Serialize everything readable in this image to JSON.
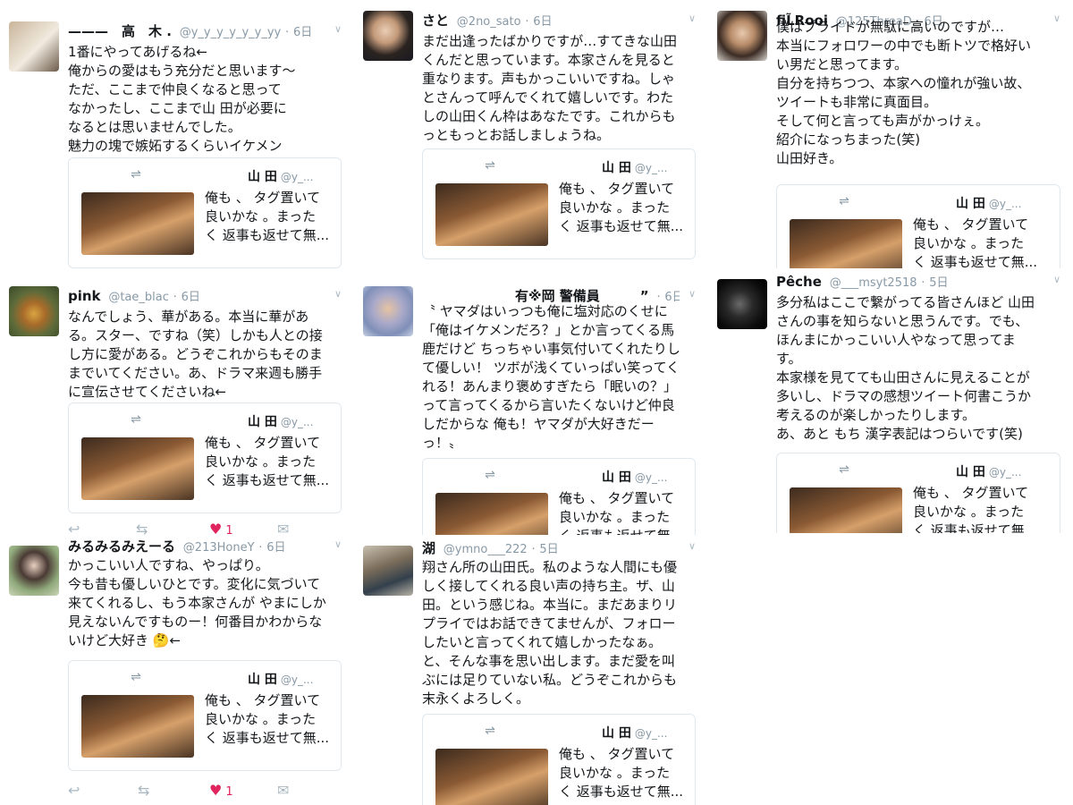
{
  "quoted": {
    "retweet_icon": "⇌",
    "name": "山 田",
    "handle": "@y_...",
    "text": "俺も 、 タグ置いて\n良いかな 。まった\nく 返事も返せて無..."
  },
  "tweets": [
    {
      "name": "———　高　木 .",
      "handle": "@y_y_y_y_y_y_yy",
      "time": "6日",
      "text": "1番にやってあげるね←\n俺からの愛はもう充分だと思います〜\nただ、ここまで仲良くなると思って\nなかったし、ここまで山 田が必要に\nなるとは思いませんでした。\n魅力の塊で嫉妬するくらいイケメン"
    },
    {
      "name": "さと",
      "handle": "@2no_sato",
      "time": "6日",
      "text": "まだ出逢ったばかりですが…すてきな山田\nくんだと思っています。本家さんを見ると\n重なります。声もかっこいいですね。しゃ\nとさんって呼んでくれて嬉しいです。わた\nしの山田くん枠はあなたです。これからも\nっともっとお話しましょうね。"
    },
    {
      "name": "fiL̃Rooi",
      "handle": "@125ThreaD",
      "time": "6日",
      "text": "僕はプライドが無駄に高いのですが…\n本当にフォロワーの中でも断トツで格好い\nい男だと思ってます。\n自分を持ちつつ、本家への憧れが強い故、\nツイートも非常に真面目。\nそして何と言っても声がかっけぇ。\n紹介になっちまった(笑)\n山田好き。"
    },
    {
      "name": "pink",
      "handle": "@tae_blac",
      "time": "6日",
      "text": "なんでしょう、華がある。本当に華があ\nる。スター、ですね（笑）しかも人との接\nし方に愛がある。どうぞこれからもそのま\nまでいてください。あ、ドラマ来週も勝手\nに宣伝させてくださいね←"
    },
    {
      "name": "有※岡 警備員　　　”",
      "handle": "",
      "time": "6日",
      "text": "〝 ヤマダはいっつも俺に塩対応のくせに\n「俺はイケメンだろ？」とか言ってくる馬\n鹿だけど ちっちゃい事気付いてくれたりし\nて優しい！ ツボが浅くていっぱい笑ってく\nれる！あんまり褒めすぎたら「眠いの？」\nって言ってくるから言いたくないけど仲良\nしだからな 俺も！ヤマダが大好きだー\nっ！〟"
    },
    {
      "name": "Pêche",
      "handle": "@___msyt2518",
      "time": "5日",
      "text": "多分私はここで繋がってる皆さんほど 山田\nさんの事を知らないと思うんです。でも、\nほんまにかっこいい人やなって思ってま\nす。\n本家様を見てても山田さんに見えることが\n多いし、ドラマの感想ツイート何書こうか\n考えるのが楽しかったりします。\nあ、あと もち 漢字表記はつらいです(笑)"
    },
    {
      "name": "みるみるみえーる",
      "handle": "@213HoneY",
      "time": "6日",
      "text": "かっこいい人ですね、やっぱり。\n今も昔も優しいひとです。変化に気づいて\n来てくれるし、もう本家さんが やまにしか\n見えないんですものー！何番目かわからな\nいけど大好き 🤔←"
    },
    {
      "name": "湖",
      "handle": "@ymno___222",
      "time": "5日",
      "text": "翔さん所の山田氏。私のような人間にも優\nしく接してくれる良い声の持ち主。ザ、山\n田。という感じね。本当に。まだあまりリ\nプライではお話できてませんが、フォロー\nしたいと言ってくれて嬉しかったなぁ。\nと、そんな事を思い出します。まだ愛を叫\nぶには足りていない私。どうぞこれからも\n末永くよろしく。"
    }
  ],
  "actions": {
    "reply_icon": "reply-icon",
    "retweet_icon": "retweet-icon",
    "like_icon": "heart-icon",
    "dm_icon": "dm-icon",
    "like_count": "1",
    "reply_glyph": "↩",
    "retweet_glyph": "⇆",
    "like_glyph": "♥",
    "dm_glyph": "✉"
  },
  "colors": {
    "name": "#14171a",
    "meta": "#8899a6",
    "like": "#e0245e",
    "border": "#e1e8ed"
  }
}
